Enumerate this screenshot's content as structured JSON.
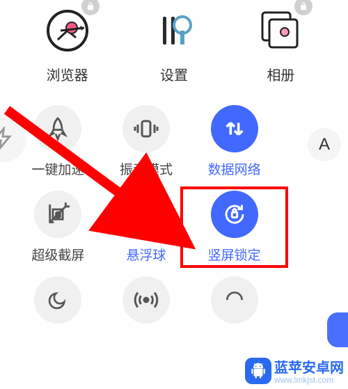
{
  "apps": {
    "browser": {
      "label": "浏览器",
      "locked": true
    },
    "settings": {
      "label": "设置",
      "locked": false
    },
    "gallery": {
      "label": "相册",
      "locked": true
    }
  },
  "quick": {
    "boost": {
      "label": "一键加速"
    },
    "vibrate": {
      "label": "振动模式"
    },
    "data": {
      "label": "数据网络"
    },
    "screenshot": {
      "label": "超级截屏"
    },
    "float": {
      "label": "悬浮球"
    },
    "portrait_lock": {
      "label": "竖屏锁定"
    }
  },
  "side": {
    "letter": "A"
  },
  "brand": {
    "name": "蓝苹安卓网",
    "url": "www.lmkjst.com"
  },
  "colors": {
    "accent": "#4169ff",
    "highlight": "#ff0000"
  }
}
